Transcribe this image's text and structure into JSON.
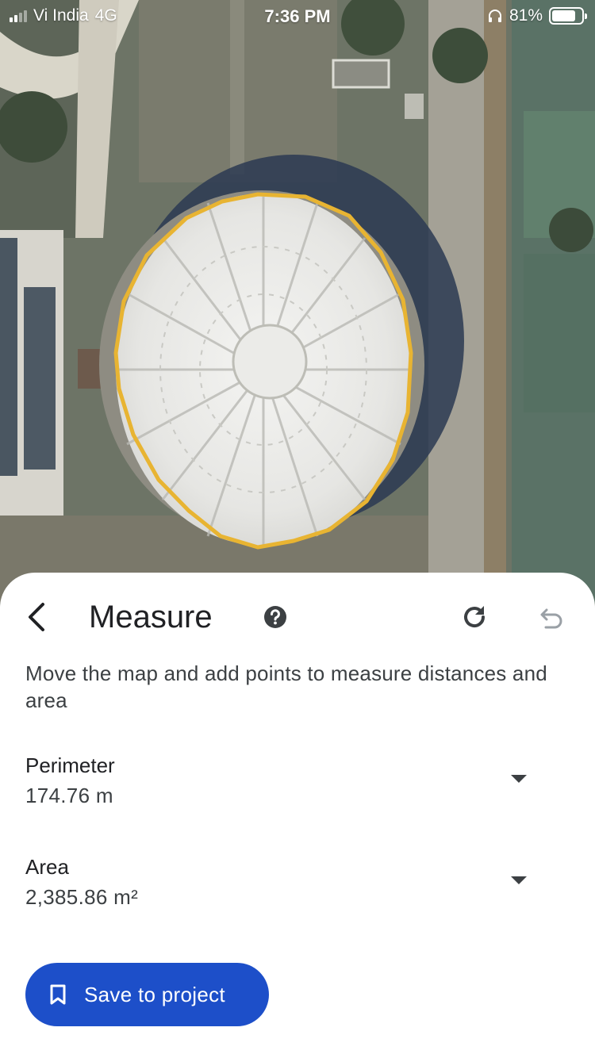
{
  "status_bar": {
    "carrier": "Vi India",
    "network": "4G",
    "time": "7:36 PM",
    "battery_percent": "81%",
    "battery_level": 0.81
  },
  "map": {
    "type": "satellite",
    "outline_color": "#e8b432"
  },
  "sheet": {
    "title": "Measure",
    "instructions": "Move the map and add points to measure distances and area",
    "perimeter": {
      "label": "Perimeter",
      "value": "174.76 m"
    },
    "area": {
      "label": "Area",
      "value": "2,385.86 m²"
    },
    "save_label": "Save to project",
    "accent_color": "#1d4fc9",
    "icons": [
      "back-arrow-icon",
      "help-icon",
      "redo-icon",
      "undo-icon",
      "chevron-down-icon",
      "bookmark-icon"
    ]
  }
}
